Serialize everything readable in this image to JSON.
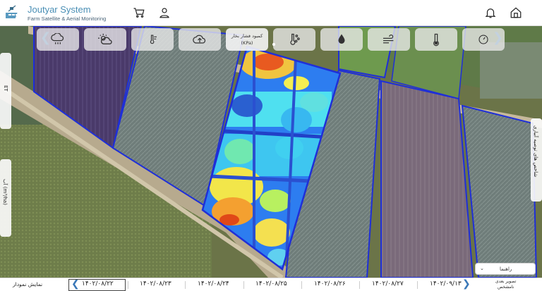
{
  "header": {
    "title": "Joutyar System",
    "subtitle": "Farm Satellite & Aerial Monitoring",
    "accent": "#4a8fb5",
    "icons": [
      "cart-icon",
      "user-icon",
      "bell-icon",
      "home-icon"
    ]
  },
  "toolbar": {
    "active_label": "کمبود فشار بخار",
    "active_unit": "(KPa)",
    "icons": [
      "cloud-rain-icon",
      "sun-cloud-icon",
      "thermometer-wind-icon",
      "cloud-upload-icon",
      "vpd-icon",
      "thermometer-dots-icon",
      "water-drop-icon",
      "wind-icon",
      "thermometer-icon",
      "gauge-icon"
    ]
  },
  "side": {
    "left_top": "ET",
    "left_bottom": "آب (m³/ha)",
    "right": "شاخص های توصیه آبیاری"
  },
  "dropdown": {
    "value": "راهنما"
  },
  "timeline": {
    "show_chart": "نمایش نمودار",
    "dates": [
      "۱۴۰۲/۰۸/۲۲",
      "۱۴۰۲/۰۸/۲۳",
      "۱۴۰۲/۰۸/۲۴",
      "۱۴۰۲/۰۸/۲۵",
      "۱۴۰۲/۰۸/۲۶",
      "۱۴۰۲/۰۸/۲۷",
      "۱۴۰۲/۰۹/۱۳"
    ],
    "selected": "۱۴۰۲/۰۸/۲۲",
    "last_line1": "تصویر بعدی",
    "last_line2": "نامشخص"
  }
}
